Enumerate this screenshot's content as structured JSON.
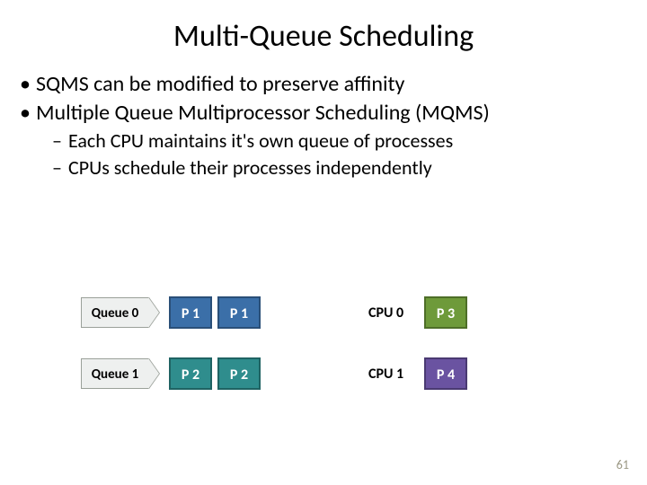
{
  "title": "Multi-Queue Scheduling",
  "bullets": {
    "l1": [
      "SQMS can be modified to preserve affinity",
      "Multiple Queue Multiprocessor Scheduling (MQMS)"
    ],
    "l2": [
      "Each CPU maintains it's own queue of processes",
      "CPUs schedule their processes independently"
    ]
  },
  "diagram": {
    "rows": [
      {
        "queue_label": "Queue 0",
        "queue_items": [
          {
            "label": "P 1",
            "color": "blue"
          },
          {
            "label": "P 1",
            "color": "blue"
          }
        ],
        "cpu_label": "CPU 0",
        "cpu_item": {
          "label": "P 3",
          "color": "green"
        }
      },
      {
        "queue_label": "Queue 1",
        "queue_items": [
          {
            "label": "P 2",
            "color": "teal"
          },
          {
            "label": "P 2",
            "color": "teal"
          }
        ],
        "cpu_label": "CPU 1",
        "cpu_item": {
          "label": "P 4",
          "color": "purple"
        }
      }
    ]
  },
  "page_number": "61"
}
